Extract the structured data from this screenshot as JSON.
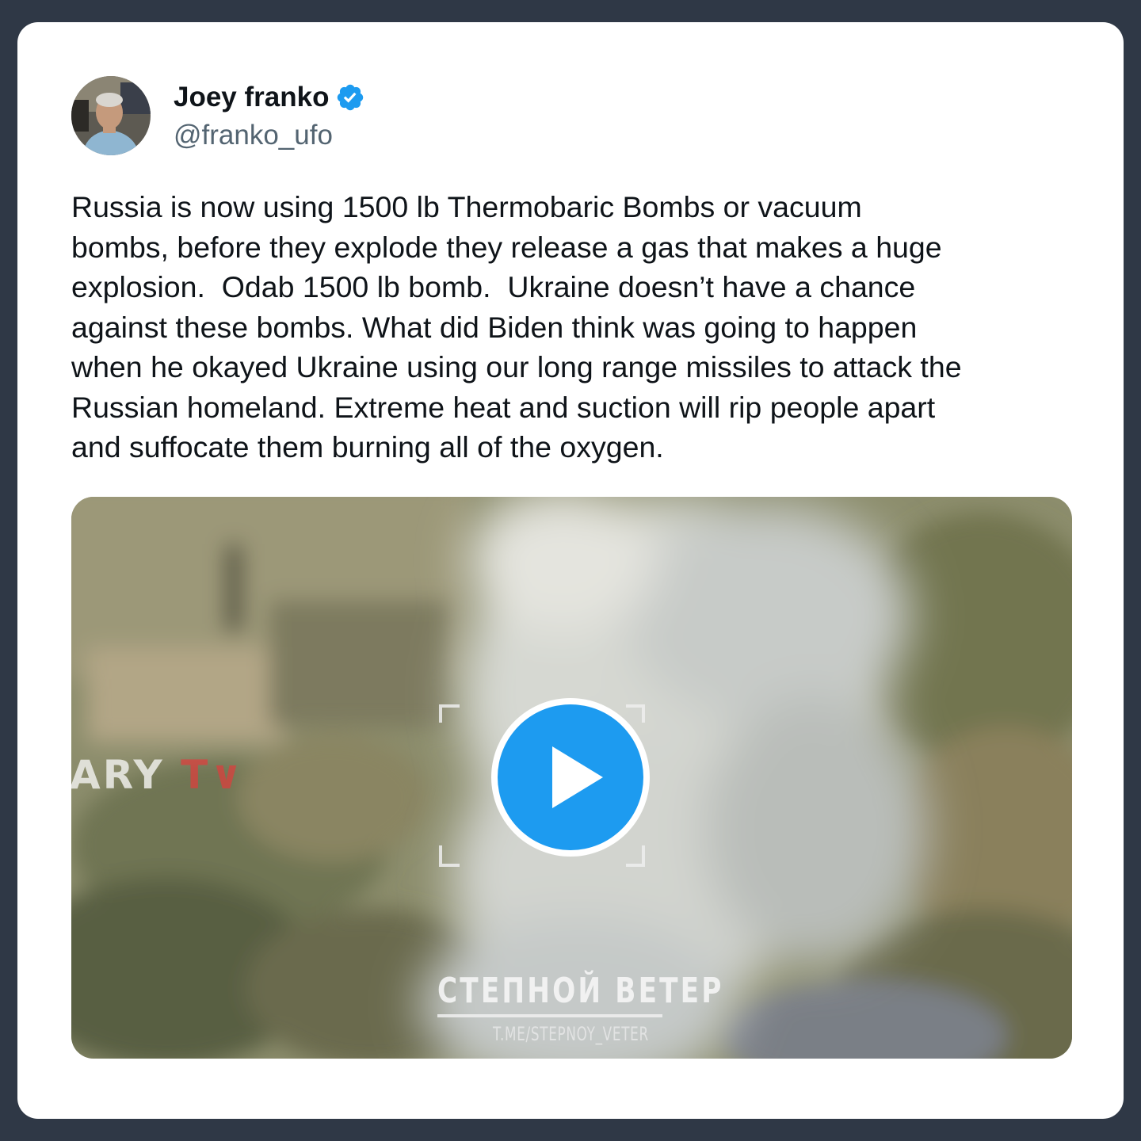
{
  "colors": {
    "page_background": "#2f3846",
    "card_background": "#ffffff",
    "verified_badge": "#1d9bf0",
    "play_button": "#1d9bf0",
    "handle_text": "#536471"
  },
  "author": {
    "display_name": "Joey franko",
    "handle": "@franko_ufo",
    "verified": true,
    "avatar_icon": "profile-photo"
  },
  "tweet": {
    "text": "Russia is now using 1500 lb Thermobaric Bombs or vacuum\nbombs, before they explode they release a gas that makes a huge\nexplosion.  Odab 1500 lb bomb.  Ukraine doesn’t have a chance\nagainst these bombs. What did Biden think was going to happen\nwhen he okayed Ukraine using our long range missiles to attack the\nRussian homeland. Extreme heat and suction will rip people apart\nand suffocate them burning all of the oxygen."
  },
  "media": {
    "type": "video",
    "play_icon": "play-icon",
    "watermark_left": "ARY",
    "watermark_left_suffix": "T",
    "watermark_title": "СТЕПНОЙ ВЕТЕР",
    "watermark_url": "T.ME/STEPNOY_VETER"
  }
}
